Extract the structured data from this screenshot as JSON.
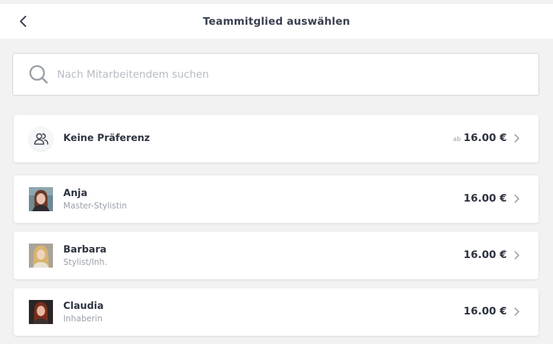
{
  "header": {
    "title": "Teammitglied auswählen"
  },
  "search": {
    "placeholder": "Nach Mitarbeitendem suchen"
  },
  "no_preference": {
    "name": "Keine Präferenz",
    "price_prefix": "ab",
    "price": "16.00 €"
  },
  "staff": [
    {
      "name": "Anja",
      "role": "Master-Stylistin",
      "price": "16.00 €",
      "hair_color": "#6b3a2a",
      "bg_color": "#6f8a96"
    },
    {
      "name": "Barbara",
      "role": "Stylist/Inh.",
      "price": "16.00 €",
      "hair_color": "#d9b46e",
      "bg_color": "#a9a39a"
    },
    {
      "name": "Claudia",
      "role": "Inhaberin",
      "price": "16.00 €",
      "hair_color": "#7a2e1c",
      "bg_color": "#2b2523"
    }
  ]
}
